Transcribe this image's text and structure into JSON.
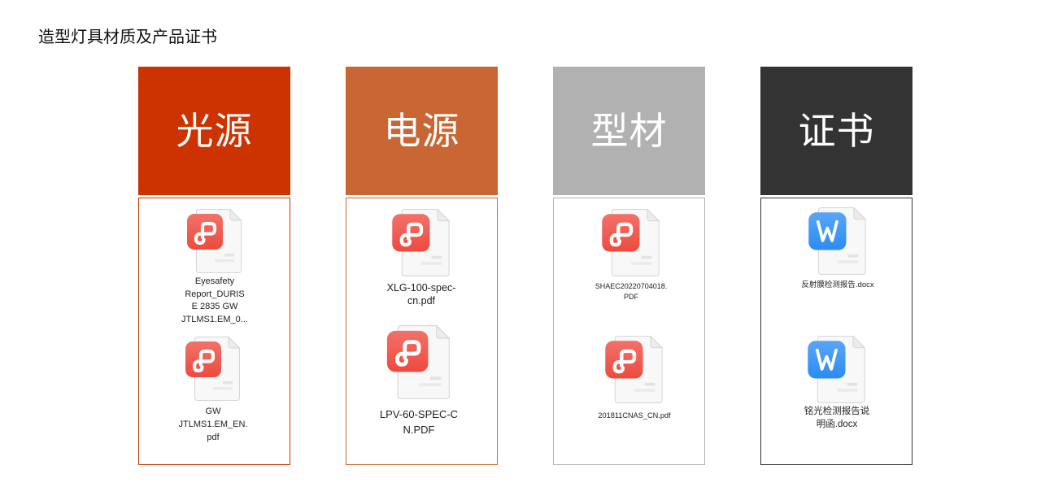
{
  "page_title": "造型灯具材质及产品证书",
  "theme": {
    "pdf_badge": "#ee4a3f",
    "word_badge": "#2b8cf4"
  },
  "columns": [
    {
      "title": "光源",
      "color": "#cc3300",
      "files": [
        {
          "icon": "pdf-file-icon",
          "name_lines": [
            "Eyesafety",
            "Report_DURIS",
            "E 2835 GW",
            "JTLMS1.EM_0..."
          ]
        },
        {
          "icon": "pdf-file-icon",
          "name_lines": [
            "GW",
            "JTLMS1.EM_EN.",
            "pdf"
          ]
        }
      ]
    },
    {
      "title": "电源",
      "color": "#c96633",
      "files": [
        {
          "icon": "pdf-file-icon",
          "name_lines": [
            "XLG-100-spec-",
            "cn.pdf"
          ]
        },
        {
          "icon": "pdf-file-icon",
          "name_lines": [
            "LPV-60-SPEC-C",
            "N.PDF"
          ]
        }
      ]
    },
    {
      "title": "型材",
      "color": "#b1b1b1",
      "files": [
        {
          "icon": "pdf-file-icon",
          "name_lines": [
            "SHAEC20220704018.",
            "PDF"
          ]
        },
        {
          "icon": "pdf-file-icon",
          "name_lines": [
            "201811CNAS_CN.pdf"
          ]
        }
      ]
    },
    {
      "title": "证书",
      "color": "#333333",
      "files": [
        {
          "icon": "word-file-icon",
          "name_lines": [
            "反射膜检测报告.docx"
          ]
        },
        {
          "icon": "word-file-icon",
          "name_lines": [
            "铭光检测报告说",
            "明函.docx"
          ]
        }
      ]
    }
  ]
}
